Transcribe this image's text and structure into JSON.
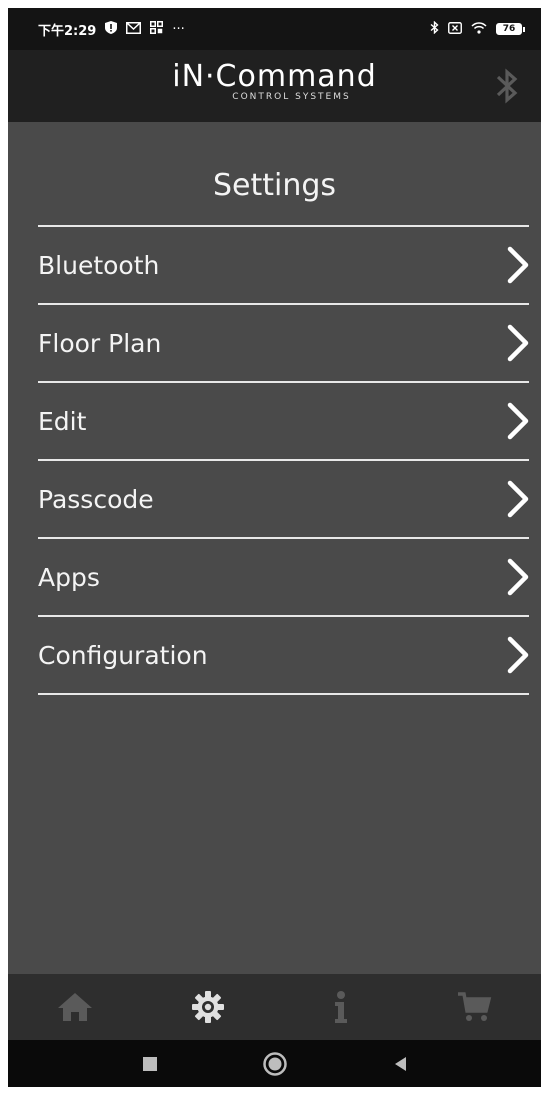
{
  "status_bar": {
    "time": "下午2:29",
    "more": "···",
    "battery": "76"
  },
  "header": {
    "logo_main": "iN·Command",
    "logo_sub": "CONTROL SYSTEMS"
  },
  "page": {
    "title": "Settings"
  },
  "menu": {
    "items": [
      {
        "label": "Bluetooth"
      },
      {
        "label": "Floor Plan"
      },
      {
        "label": "Edit"
      },
      {
        "label": "Passcode"
      },
      {
        "label": "Apps"
      },
      {
        "label": "Configuration"
      }
    ]
  },
  "colors": {
    "background": "#4a4a4a",
    "header": "#202020",
    "status_bar": "#141414",
    "tab_bar": "#2e2e2e",
    "text": "#f4f4f4",
    "inactive_icon": "#5a5a5a"
  },
  "tabs": [
    {
      "icon": "home-icon"
    },
    {
      "icon": "gear-icon"
    },
    {
      "icon": "info-icon"
    },
    {
      "icon": "cart-icon"
    }
  ]
}
